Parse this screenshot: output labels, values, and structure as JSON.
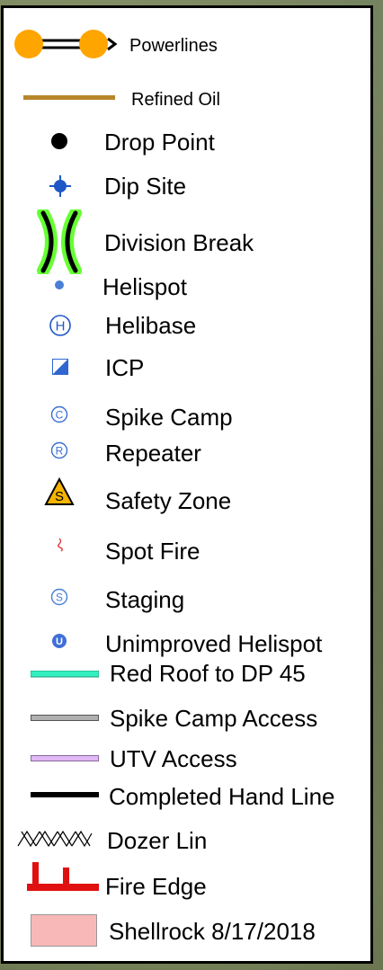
{
  "legend": {
    "items": [
      {
        "label": "Powerlines",
        "icon": "powerline-symbol",
        "color": "#ffa500"
      },
      {
        "label": "Refined Oil",
        "icon": "oil-line-symbol",
        "color": "#b8862b"
      },
      {
        "label": "Drop Point",
        "icon": "black-dot-icon",
        "color": "#000000"
      },
      {
        "label": "Dip Site",
        "icon": "blue-diamond-icon",
        "color": "#1f57c8"
      },
      {
        "label": "Division Break",
        "icon": "division-break-icon",
        "color": "#66ff33"
      },
      {
        "label": "Helispot",
        "icon": "small-blue-dot-icon",
        "color": "#4a7fd6"
      },
      {
        "label": "Helibase",
        "icon": "circled-h-icon",
        "color": "#1f57c8"
      },
      {
        "label": "ICP",
        "icon": "icp-triangle-square-icon",
        "color": "#2f66d0"
      },
      {
        "label": "Spike Camp",
        "icon": "circled-c-icon",
        "color": "#3a6fd0"
      },
      {
        "label": "Repeater",
        "icon": "circled-r-icon",
        "color": "#3a6fd0"
      },
      {
        "label": "Safety Zone",
        "icon": "safety-zone-triangle-icon",
        "color": "#f5b400"
      },
      {
        "label": "Spot Fire",
        "icon": "spot-fire-icon",
        "color": "#e03030"
      },
      {
        "label": "Staging",
        "icon": "circled-s-icon",
        "color": "#4a7fd6"
      },
      {
        "label": "Unimproved Helispot",
        "icon": "unimproved-helispot-icon",
        "color": "#3f6fd8"
      },
      {
        "label": "Red Roof to DP 45",
        "icon": "teal-line-symbol",
        "color": "#33f0c0"
      },
      {
        "label": "Spike Camp Access",
        "icon": "gray-line-symbol",
        "color": "#9a9a9a"
      },
      {
        "label": "UTV Access",
        "icon": "lavender-line-symbol",
        "color": "#d8a8f0"
      },
      {
        "label": "Completed Hand Line",
        "icon": "black-line-symbol",
        "color": "#000000"
      },
      {
        "label": "Dozer Lin",
        "icon": "dozer-line-symbol",
        "color": "#000000"
      },
      {
        "label": "Fire Edge",
        "icon": "fire-edge-symbol",
        "color": "#e01010"
      },
      {
        "label": "Shellrock 8/17/2018",
        "icon": "pink-area-swatch",
        "color": "#f8b8b8"
      }
    ]
  }
}
